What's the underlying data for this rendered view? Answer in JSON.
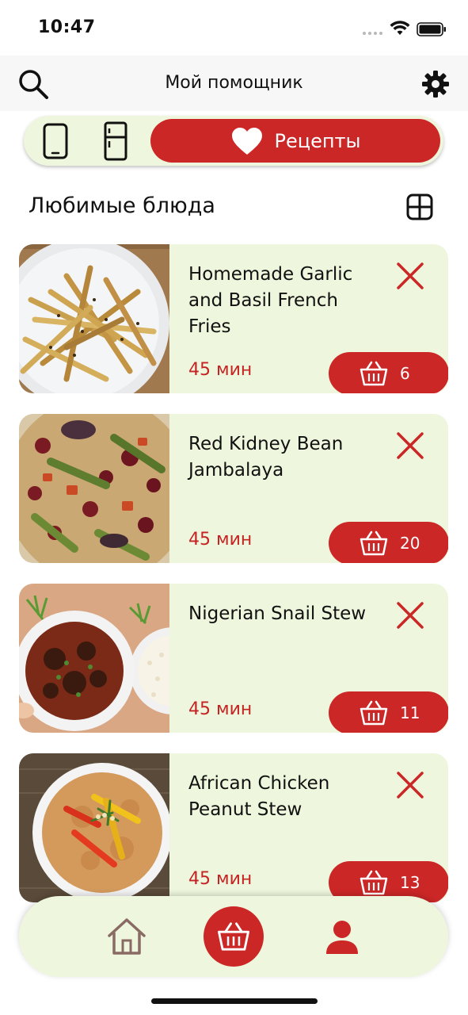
{
  "status_bar": {
    "time": "10:47"
  },
  "header": {
    "title": "Мой помощник"
  },
  "segment": {
    "recipes_label": "Рецепты"
  },
  "section": {
    "title": "Любимые блюда"
  },
  "recipes": [
    {
      "name": "Homemade Garlic and Basil French Fries",
      "time": "45 мин",
      "basket_count": "6"
    },
    {
      "name": "Red Kidney Bean Jambalaya",
      "time": "45 мин",
      "basket_count": "20"
    },
    {
      "name": "Nigerian Snail Stew",
      "time": "45 мин",
      "basket_count": "11"
    },
    {
      "name": "African Chicken Peanut Stew",
      "time": "45 мин",
      "basket_count": "13"
    }
  ],
  "colors": {
    "accent": "#cc2727",
    "card_bg": "#eef7dd",
    "header_bg": "#f7f7f7"
  }
}
